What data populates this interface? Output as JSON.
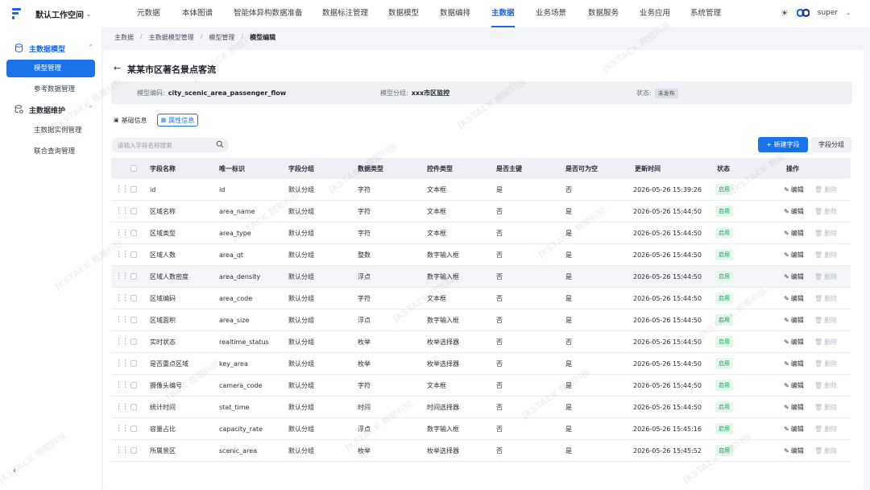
{
  "topbar": {
    "workspace": "默认工作空间",
    "nav": [
      "元数据",
      "本体图谱",
      "智能体异构数据准备",
      "数据标注管理",
      "数据模型",
      "数据编排",
      "主数据",
      "业务场景",
      "数据服务",
      "业务应用",
      "系统管理"
    ],
    "active_nav": "主数据",
    "user": "super"
  },
  "sidebar": {
    "groups": [
      {
        "label": "主数据模型",
        "items": [
          "模型管理",
          "参考数据管理"
        ]
      },
      {
        "label": "主数据维护",
        "items": [
          "主数据实例管理",
          "联合查询管理"
        ]
      }
    ],
    "active_item": "模型管理"
  },
  "breadcrumb": [
    "主数据",
    "主数据模型管理",
    "模型管理",
    "模型编辑"
  ],
  "page": {
    "title": "某某市区著名景点客流",
    "info": {
      "code_label": "模型编码:",
      "code_value": "city_scenic_area_passenger_flow",
      "group_label": "模型分组:",
      "group_value": "xxx市区监控",
      "status_label": "状态:",
      "status_value": "未发布"
    },
    "tabs": [
      "基础信息",
      "属性信息"
    ],
    "active_tab": "属性信息",
    "search_placeholder": "请输入字段名称搜索",
    "new_button": "新建字段",
    "group_button": "字段分组"
  },
  "table": {
    "headers": [
      "字段名称",
      "唯一标识",
      "字段分组",
      "数据类型",
      "控件类型",
      "是否主键",
      "是否可为空",
      "更新时间",
      "状态",
      "操作"
    ],
    "edit_label": "编辑",
    "delete_label": "删除",
    "rows": [
      {
        "name": "id",
        "key": "id",
        "group": "默认分组",
        "dtype": "字符",
        "ctrl": "文本框",
        "pk": "是",
        "nullable": "否",
        "time": "2026-05-26 15:39:26",
        "status": "启用"
      },
      {
        "name": "区域名称",
        "key": "area_name",
        "group": "默认分组",
        "dtype": "字符",
        "ctrl": "文本框",
        "pk": "否",
        "nullable": "是",
        "time": "2026-05-26 15:44:50",
        "status": "启用"
      },
      {
        "name": "区域类型",
        "key": "area_type",
        "group": "默认分组",
        "dtype": "字符",
        "ctrl": "文本框",
        "pk": "否",
        "nullable": "是",
        "time": "2026-05-26 15:44:50",
        "status": "启用"
      },
      {
        "name": "区域人数",
        "key": "area_qt",
        "group": "默认分组",
        "dtype": "整数",
        "ctrl": "数字输入框",
        "pk": "否",
        "nullable": "是",
        "time": "2026-05-26 15:44:50",
        "status": "启用"
      },
      {
        "name": "区域人数密度",
        "key": "area_density",
        "group": "默认分组",
        "dtype": "浮点",
        "ctrl": "数字输入框",
        "pk": "否",
        "nullable": "是",
        "time": "2026-05-26 15:44:50",
        "status": "启用"
      },
      {
        "name": "区域编码",
        "key": "area_code",
        "group": "默认分组",
        "dtype": "字符",
        "ctrl": "文本框",
        "pk": "否",
        "nullable": "是",
        "time": "2026-05-26 15:44:50",
        "status": "启用"
      },
      {
        "name": "区域面积",
        "key": "area_size",
        "group": "默认分组",
        "dtype": "浮点",
        "ctrl": "数字输入框",
        "pk": "否",
        "nullable": "是",
        "time": "2026-05-26 15:44:50",
        "status": "启用"
      },
      {
        "name": "实时状态",
        "key": "realtime_status",
        "group": "默认分组",
        "dtype": "枚举",
        "ctrl": "枚举选择器",
        "pk": "否",
        "nullable": "否",
        "time": "2026-05-26 15:44:50",
        "status": "启用"
      },
      {
        "name": "是否重点区域",
        "key": "key_area",
        "group": "默认分组",
        "dtype": "枚举",
        "ctrl": "枚举选择器",
        "pk": "否",
        "nullable": "是",
        "time": "2026-05-26 15:44:50",
        "status": "启用"
      },
      {
        "name": "摄像头编号",
        "key": "camera_code",
        "group": "默认分组",
        "dtype": "字符",
        "ctrl": "文本框",
        "pk": "否",
        "nullable": "是",
        "time": "2026-05-26 15:44:50",
        "status": "启用"
      },
      {
        "name": "统计时间",
        "key": "stat_time",
        "group": "默认分组",
        "dtype": "时间",
        "ctrl": "时间选择器",
        "pk": "否",
        "nullable": "是",
        "time": "2026-05-26 15:44:50",
        "status": "启用"
      },
      {
        "name": "容量占比",
        "key": "capacity_rate",
        "group": "默认分组",
        "dtype": "浮点",
        "ctrl": "数字输入框",
        "pk": "否",
        "nullable": "是",
        "time": "2026-05-26 15:45:16",
        "status": "启用"
      },
      {
        "name": "所属景区",
        "key": "scenic_area",
        "group": "默认分组",
        "dtype": "枚举",
        "ctrl": "枚举选择器",
        "pk": "否",
        "nullable": "是",
        "time": "2026-05-26 15:45:52",
        "status": "启用"
      }
    ]
  },
  "watermark": "JKSTACK 精鲲科技",
  "colors": {
    "accent": "#1a73e8",
    "status_green": "#22a35a"
  }
}
